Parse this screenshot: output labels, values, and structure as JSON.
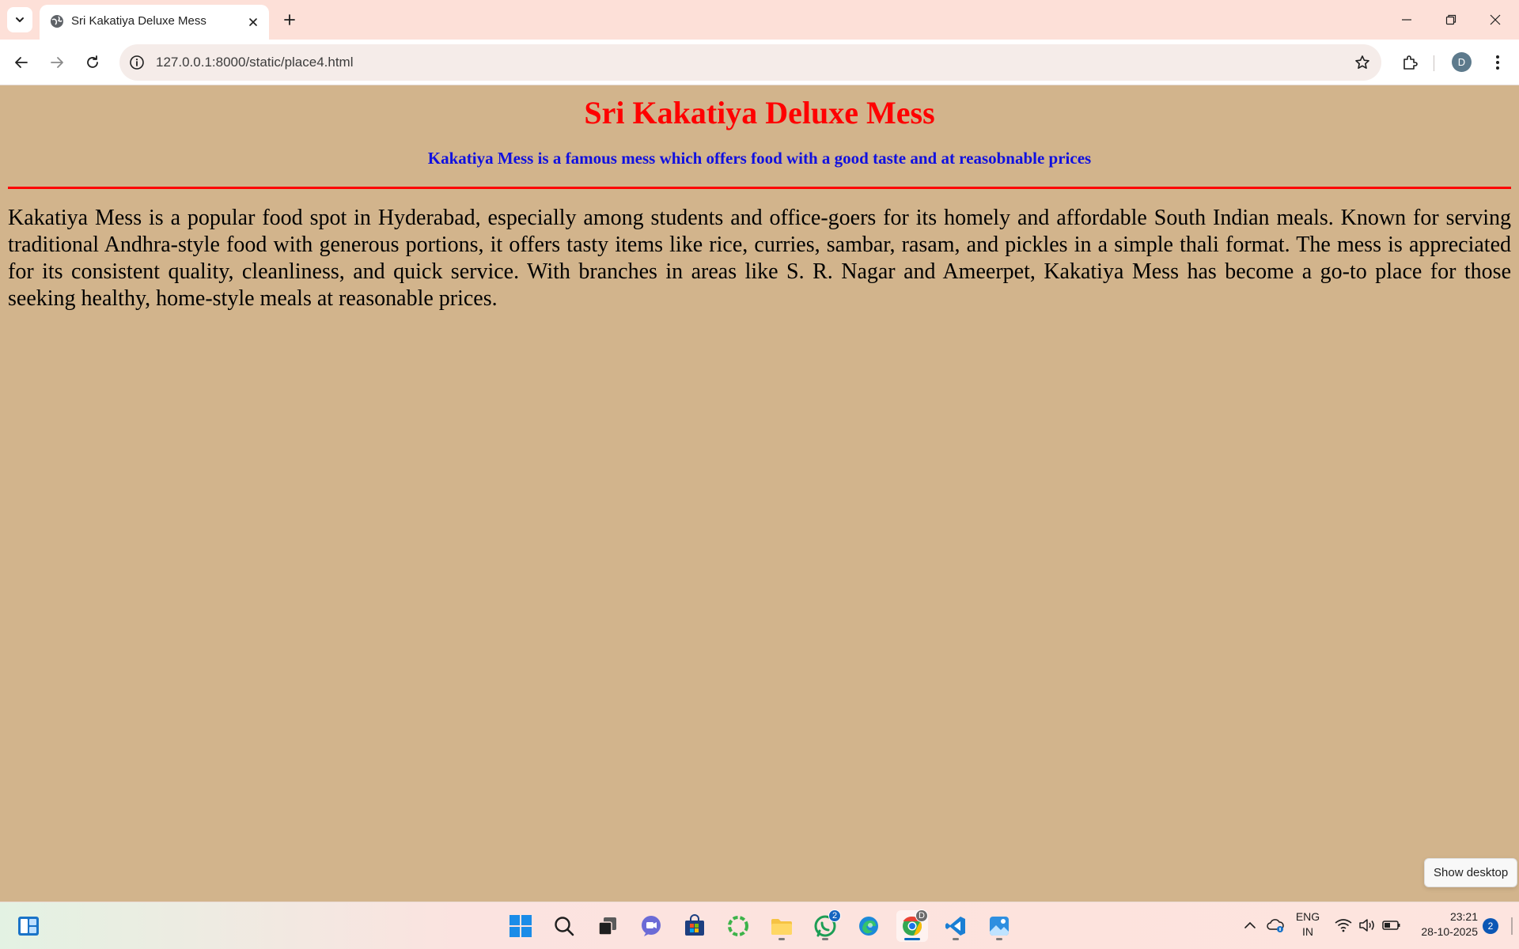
{
  "browser": {
    "tab": {
      "title": "Sri Kakatiya Deluxe Mess"
    },
    "address_bar": {
      "url": "127.0.0.1:8000/static/place4.html"
    },
    "profile_initial": "D"
  },
  "page": {
    "heading": "Sri Kakatiya Deluxe Mess",
    "subheading": "Kakatiya Mess is a famous mess which offers food with a good taste and at reasobnable prices",
    "paragraph": "Kakatiya Mess is a popular food spot in Hyderabad, especially among students and office-goers for its homely and affordable South Indian meals. Known for serving traditional Andhra-style food with generous portions, it offers tasty items like rice, curries, sambar, rasam, and pickles in a simple thali format. The mess is appreciated for its consistent quality, cleanliness, and quick service. With branches in areas like S. R. Nagar and Ameerpet, Kakatiya Mess has become a go-to place for those seeking healthy, home-style meals at reasonable prices.",
    "colors": {
      "background": "#d2b48c",
      "heading": "#ff0000",
      "subheading": "#1010e0",
      "rule": "#ff0000"
    }
  },
  "tooltip": {
    "show_desktop": "Show desktop"
  },
  "taskbar": {
    "whatsapp_badge": "2",
    "chrome_profile_badge": "D",
    "language": {
      "line1": "ENG",
      "line2": "IN"
    },
    "clock": {
      "time": "23:21",
      "date": "28-10-2025"
    },
    "notification_count": "2"
  }
}
